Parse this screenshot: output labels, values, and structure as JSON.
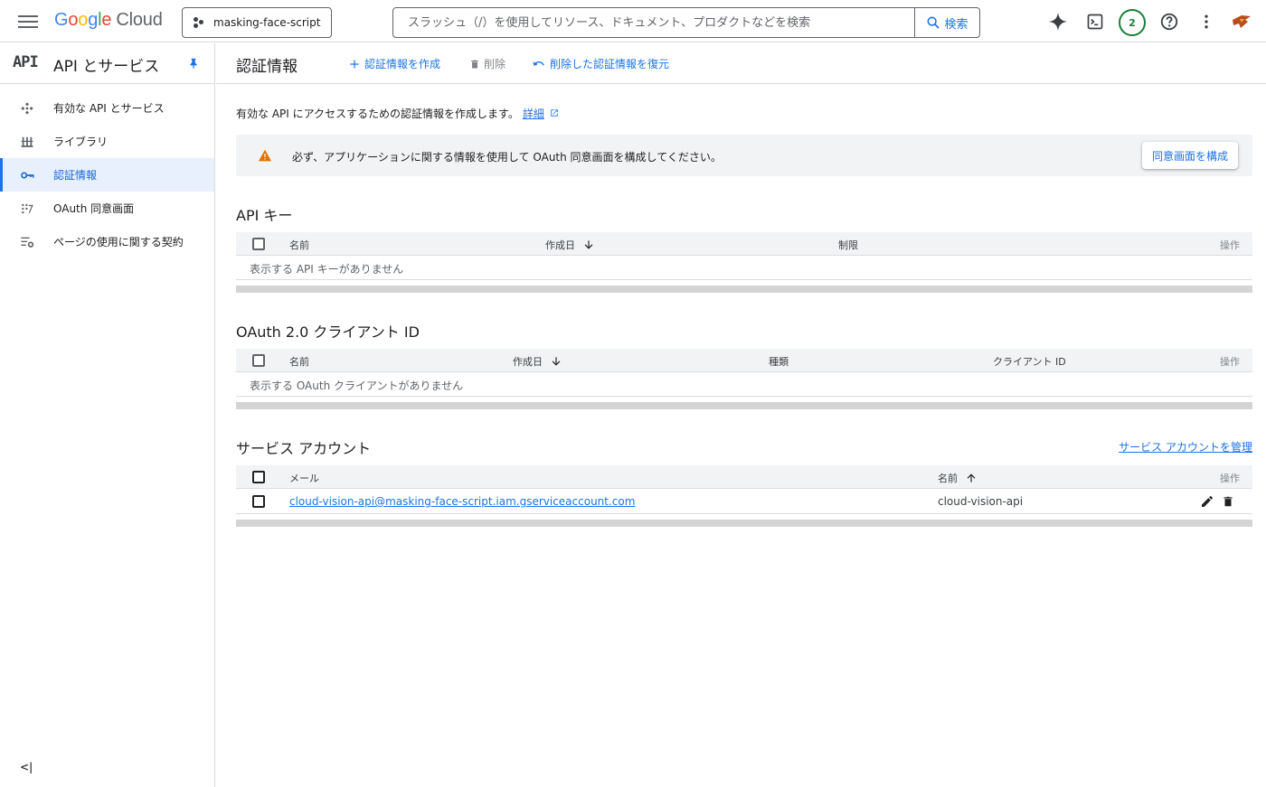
{
  "header": {
    "logo_google": [
      "G",
      "o",
      "o",
      "g",
      "l",
      "e"
    ],
    "logo_cloud": "Cloud",
    "project_name": "masking-face-script",
    "search_placeholder": "スラッシュ（/）を使用してリソース、ドキュメント、プロダクトなどを検索",
    "search_button": "検索",
    "notification_count": "2"
  },
  "sidebar": {
    "logo": "API",
    "title": "API とサービス",
    "items": [
      {
        "label": "有効な API とサービス",
        "icon": "api-icon",
        "active": false
      },
      {
        "label": "ライブラリ",
        "icon": "library-icon",
        "active": false
      },
      {
        "label": "認証情報",
        "icon": "key-icon",
        "active": true
      },
      {
        "label": "OAuth 同意画面",
        "icon": "oauth-icon",
        "active": false
      },
      {
        "label": "ページの使用に関する契約",
        "icon": "settings-list-icon",
        "active": false
      }
    ],
    "collapse": "<|"
  },
  "page": {
    "title": "認証情報",
    "actions": {
      "create": "認証情報を作成",
      "delete": "削除",
      "restore": "削除した認証情報を復元"
    },
    "description": "有効な API にアクセスするための認証情報を作成します。",
    "details_link": "詳細",
    "alert": {
      "message": "必ず、アプリケーションに関する情報を使用して OAuth 同意画面を構成してください。",
      "button": "同意画面を構成"
    }
  },
  "api_keys": {
    "title": "API キー",
    "columns": [
      "名前",
      "作成日",
      "制限",
      "操作"
    ],
    "empty": "表示する API キーがありません"
  },
  "oauth_clients": {
    "title": "OAuth 2.0 クライアント ID",
    "columns": [
      "名前",
      "作成日",
      "種類",
      "クライアント ID",
      "操作"
    ],
    "empty": "表示する OAuth クライアントがありません"
  },
  "service_accounts": {
    "title": "サービス アカウント",
    "manage_link": "サービス アカウントを管理",
    "columns": [
      "メール",
      "名前",
      "操作"
    ],
    "rows": [
      {
        "email": "cloud-vision-api@masking-face-script.iam.gserviceaccount.com",
        "name": "cloud-vision-api"
      }
    ]
  },
  "colors": {
    "accent": "#1a73e8",
    "warning": "#e37400",
    "badge": "#188038"
  }
}
